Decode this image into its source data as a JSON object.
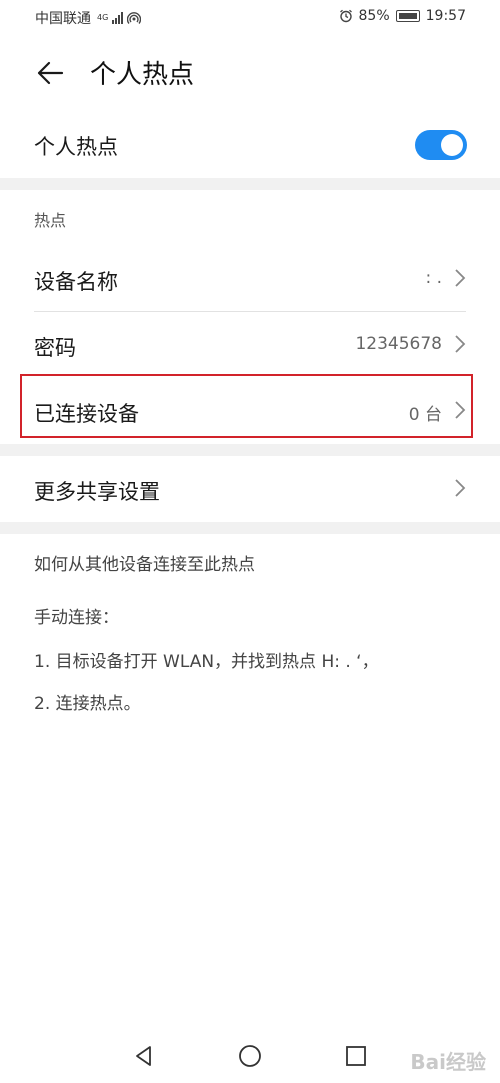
{
  "status_bar": {
    "carrier": "中国联通",
    "network": "4G",
    "battery": "85%",
    "time": "19:57"
  },
  "header": {
    "title": "个人热点"
  },
  "hotspot_toggle": {
    "label": "个人热点",
    "on": true
  },
  "hotspot_section": {
    "label": "热点",
    "items": [
      {
        "label": "设备名称",
        "value": ":                    ."
      },
      {
        "label": "密码",
        "value": "12345678"
      },
      {
        "label": "已连接设备",
        "value": "0 台"
      }
    ]
  },
  "more_settings": {
    "label": "更多共享设置"
  },
  "help": {
    "title": "如何从其他设备连接至此热点",
    "manual": "手动连接：",
    "step1": "1. 目标设备打开 WLAN，并找到热点 H:   .  ‘，",
    "step2": "2. 连接热点。"
  },
  "watermark": "Bai经验",
  "colors": {
    "accent": "#1f8cf2",
    "highlight": "#d2232a"
  }
}
